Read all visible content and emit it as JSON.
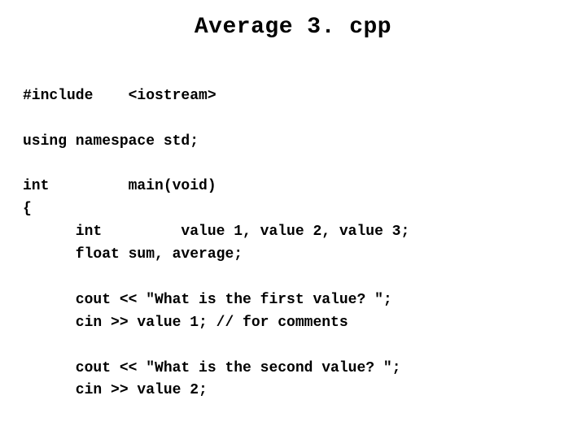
{
  "title": "Average 3. cpp",
  "lines": {
    "l0": "#include    <iostream>",
    "l1": "",
    "l2": "using namespace std;",
    "l3": "",
    "l4": "int         main(void)",
    "l5": "{",
    "l6": "      int         value 1, value 2, value 3;",
    "l7": "      float sum, average;",
    "l8": "",
    "l9": "      cout << \"What is the first value? \";",
    "l10": "      cin >> value 1; // for comments",
    "l11": "",
    "l12": "      cout << \"What is the second value? \";",
    "l13": "      cin >> value 2;"
  }
}
